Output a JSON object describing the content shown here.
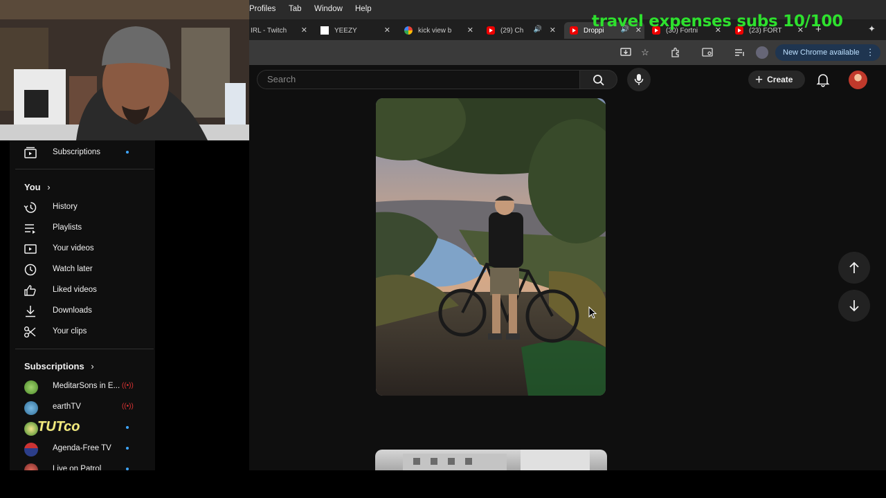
{
  "menubar": {
    "items": [
      "Profiles",
      "Tab",
      "Window",
      "Help"
    ]
  },
  "tabs": [
    {
      "title": "IRL - Twitch",
      "favicon": "twitch"
    },
    {
      "title": "YEEZY",
      "favicon": "blank-white"
    },
    {
      "title": "kick view b",
      "favicon": "google"
    },
    {
      "title": "(29) Ch",
      "favicon": "youtube"
    },
    {
      "title": "Droppi",
      "favicon": "youtube"
    },
    {
      "title": "(30) Fortni",
      "favicon": "youtube"
    },
    {
      "title": "(23) FORT",
      "favicon": "youtube"
    }
  ],
  "overlay": {
    "text": "travel expenses subs 10/100",
    "color": "#2ee02e"
  },
  "toolbar": {
    "new_chrome_label": "New Chrome available"
  },
  "header": {
    "search_placeholder": "Search",
    "create_label": "Create"
  },
  "sidebar": {
    "top_item": "Subscriptions",
    "you_section": "You",
    "you_items": [
      "History",
      "Playlists",
      "Your videos",
      "Watch later",
      "Liked videos",
      "Downloads",
      "Your clips"
    ],
    "subs_section": "Subscriptions",
    "channels": [
      {
        "name": "MeditarSons in E...",
        "status": "live"
      },
      {
        "name": "earthTV",
        "status": "live"
      },
      {
        "name": "TUTco",
        "status": "new"
      },
      {
        "name": "Agenda-Free TV",
        "status": "new"
      },
      {
        "name": "Live on Patrol",
        "status": "new"
      }
    ]
  },
  "colors": {
    "accent_blue": "#3ea6ff",
    "live_red": "#d33",
    "new_chrome_bg": "#1f3550"
  }
}
